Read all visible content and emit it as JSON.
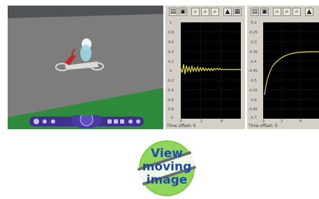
{
  "viewer": {
    "background": "#4a4c4d",
    "floor_color": "#7a7a7a",
    "grass_color": "#2f8a3a"
  },
  "scope_left": {
    "time_offset": "Time offset: 0",
    "y_ticks": [
      "1",
      "0.8",
      "0.6",
      "0.4",
      "0.2",
      "0",
      "-0.2",
      "-0.4",
      "-0.6",
      "-0.8",
      "-1"
    ],
    "x_ticks": [
      "0",
      "2",
      "4"
    ]
  },
  "scope_right": {
    "time_offset": "Time offset: 0",
    "y_ticks": [
      "-0.2",
      "-0.25",
      "-0.3",
      "-0.35",
      "-0.4",
      "-0.45",
      "-0.5",
      "-0.55",
      "-0.6",
      "-0.65",
      "-0.7"
    ],
    "x_ticks": [
      "0",
      "2",
      "4"
    ]
  },
  "badge": {
    "line1": "View",
    "line2": "moving",
    "line3": "image",
    "text_color": "#1f4aa8",
    "circle_color": "#7fc94a"
  },
  "icons": [
    "print-icon",
    "params-icon",
    "zoom-icon",
    "zoom-x-icon",
    "zoom-y-icon",
    "autoscale-icon",
    "save-axes-icon"
  ]
}
